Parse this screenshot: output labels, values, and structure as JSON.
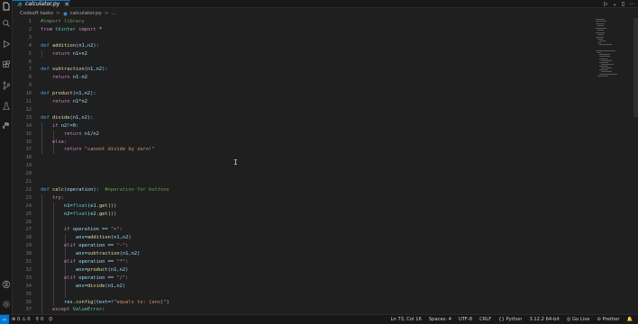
{
  "tab": {
    "label": "calculator.py",
    "close": "✕"
  },
  "titlebar_actions": [
    "▷",
    "⌄",
    "▯",
    "⋯"
  ],
  "breadcrumb": {
    "root": "Codsoft tasks",
    "sep": ">",
    "file": "calculator.py",
    "more": "..."
  },
  "line_numbers": [
    "1",
    "2",
    "3",
    "4",
    "5",
    "6",
    "7",
    "8",
    "9",
    "10",
    "11",
    "12",
    "13",
    "14",
    "15",
    "16",
    "17",
    "18",
    "19",
    "20",
    "21",
    "22",
    "23",
    "24",
    "25",
    "26",
    "27",
    "28",
    "29",
    "30",
    "31",
    "32",
    "33",
    "34",
    "35",
    "36",
    "37"
  ],
  "code": {
    "l1": "#import library",
    "l2_kw": "from",
    "l2_mod": " tkinter ",
    "l2_kw2": "import",
    "l2_rest": " *",
    "l4_def": "def ",
    "l4_fn": "addition",
    "l4_rest": "(n1,n2):",
    "l5_kw": "return",
    "l5_rest": " n1+n2",
    "l7_def": "def ",
    "l7_fn": "subtraction",
    "l7_rest": "(n1,n2):",
    "l8_kw": "return",
    "l8_rest": " n1-n2",
    "l10_def": "def ",
    "l10_fn": "product",
    "l10_rest": "(n1,n2):",
    "l11_kw": "return",
    "l11_rest": " n1*n2",
    "l13_def": "def ",
    "l13_fn": "divide",
    "l13_rest": "(n1,n2):",
    "l14_kw": "if",
    "l14_rest": " n2!=0:",
    "l15_kw": "return",
    "l15_rest": " n1/n2",
    "l16_kw": "else:",
    "l17_kw": "return",
    "l17_str": " \"cannot divide by zero!\"",
    "l21_def": "def ",
    "l21_fn": "calc",
    "l21_rest": "(operation):  ",
    "l21_cm": "#operation for buttons",
    "l22_kw": "try:",
    "l23_a": "n1=",
    "l23_fn": "float",
    "l23_b": "(e1.",
    "l23_fn2": "get",
    "l23_c": "())",
    "l24_a": "n2=",
    "l24_fn": "float",
    "l24_b": "(e2.",
    "l24_fn2": "get",
    "l24_c": "())",
    "l26_kw": "if",
    "l26_a": " operation == ",
    "l26_str": "\"+\"",
    "l26_b": ":",
    "l27_a": "ans=",
    "l27_fn": "addition",
    "l27_b": "(n1,n2)",
    "l28_kw": "elif",
    "l28_a": " operation == ",
    "l28_str": "\"-\"",
    "l28_b": ":",
    "l29_a": "ans=",
    "l29_fn": "subtraction",
    "l29_b": "(n1,n2)",
    "l30_kw": "elif",
    "l30_a": " operation == ",
    "l30_str": "\"*\"",
    "l30_b": ":",
    "l31_a": "ans=",
    "l31_fn": "product",
    "l31_b": "(n1,n2)",
    "l32_kw": "elif",
    "l32_a": " operation == ",
    "l32_str": "\"/\"",
    "l32_b": ":",
    "l33_a": "ans=",
    "l33_fn": "divide",
    "l33_b": "(n1,n2)",
    "l35_a": "res.",
    "l35_fn": "config",
    "l35_b": "(text=",
    "l35_dk": "f",
    "l35_str": "\"equals to: {ans}\"",
    "l35_c": ")",
    "l36_kw": "except",
    "l36_ty": " ValueError",
    "l36_b": ":"
  },
  "status": {
    "errors": "⊗ 0 ⚠ 0",
    "ports": "⚲ 0",
    "position": "Ln 73, Col 16",
    "spaces": "Spaces: 4",
    "encoding": "UTF-8",
    "eol": "CRLF",
    "language": "{} Python",
    "interpreter": "3.12.2 64-bit",
    "golive": "◎ Go Live",
    "prettier": "⊘ Prettier",
    "bell": "🔔"
  },
  "colors": {
    "accent": "#0078d4",
    "editor_bg": "#1f1f1f",
    "keyword": "#c586c0",
    "function": "#dcdcaa",
    "string": "#ce9178",
    "comment": "#6a9955"
  }
}
